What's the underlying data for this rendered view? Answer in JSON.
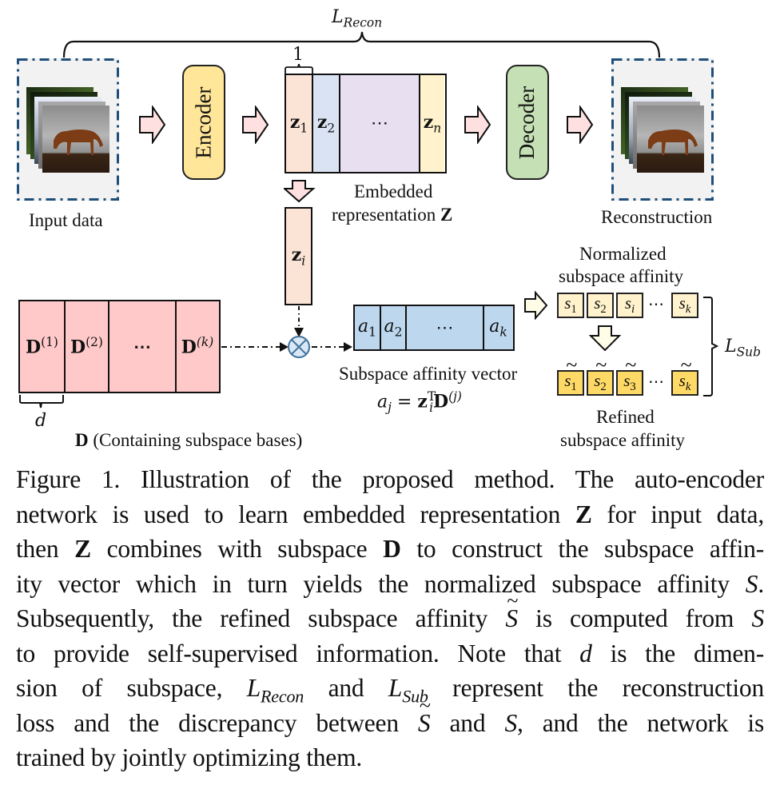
{
  "figure": {
    "loss_recon_label": "L",
    "loss_recon_sub": "Recon",
    "input": {
      "label": "Input data"
    },
    "encoder": {
      "label": "Encoder"
    },
    "decoder": {
      "label": "Decoder"
    },
    "reconstruction": {
      "label": "Reconstruction"
    },
    "embedding": {
      "width_marker": "1",
      "cells": [
        {
          "base": "z",
          "sub": "1",
          "color": "#fbe3d6"
        },
        {
          "base": "z",
          "sub": "2",
          "color": "#dae3f3"
        },
        {
          "base": "⋯",
          "sub": "",
          "color": "#e8e0f0"
        },
        {
          "base": "z",
          "sub": "n",
          "color": "#fff2cc"
        }
      ],
      "label_line1": "Embedded",
      "label_line2": "representation ",
      "label_symbol": "Z"
    },
    "zi": {
      "base": "z",
      "sub": "i"
    },
    "dictionary": {
      "cells": [
        {
          "base": "D",
          "sup": "(1)"
        },
        {
          "base": "D",
          "sup": "(2)"
        },
        {
          "base": "⋯",
          "sup": ""
        },
        {
          "base": "D",
          "sup": "(k)"
        }
      ],
      "dim_label": "d",
      "caption_symbol": "D",
      "caption_text": " (Containing subspace bases)",
      "color": "#ffc9c9"
    },
    "operator": {
      "symbol": "⊗"
    },
    "affinity_vector": {
      "cells": [
        {
          "base": "a",
          "sub": "1"
        },
        {
          "base": "a",
          "sub": "2"
        },
        {
          "base": "⋯",
          "sub": ""
        },
        {
          "base": "a",
          "sub": "k"
        }
      ],
      "label": "Subspace affinity vector",
      "formula_lhs": "a",
      "formula_lhs_sub": "j",
      "formula_eq": " = ",
      "formula_z": "z",
      "formula_z_sub": "i",
      "formula_z_sup": "T",
      "formula_D": "D",
      "formula_D_sup": "(j)",
      "color": "#bdd7ee"
    },
    "normalized": {
      "label_line1": "Normalized",
      "label_line2": "subspace affinity",
      "cells": [
        {
          "base": "s",
          "sub": "1"
        },
        {
          "base": "s",
          "sub": "2"
        },
        {
          "base": "s",
          "sub": "i"
        },
        {
          "base": "s",
          "sub": "k"
        }
      ],
      "ellipsis": "⋯",
      "color": "#fff2cc"
    },
    "refined": {
      "label_line1": "Refined",
      "label_line2": "subspace affinity",
      "cells": [
        {
          "base": "s",
          "sub": "1"
        },
        {
          "base": "s",
          "sub": "2"
        },
        {
          "base": "s",
          "sub": "3"
        },
        {
          "base": "s",
          "sub": "k"
        }
      ],
      "ellipsis": "⋯",
      "color": "#ffd966"
    },
    "loss_sub_label": "L",
    "loss_sub_sub": "Sub",
    "colors": {
      "frame_dash": "#1f4e79",
      "frame_fill": "#f2f2f2",
      "encoder": "#ffe699",
      "decoder": "#c5e0b4",
      "arrow_pink": "#ffe0e0",
      "arrow_cream": "#fffde7",
      "operator_fill": "#dae8f5",
      "operator_stroke": "#41719c"
    }
  },
  "caption": {
    "lines": [
      [
        "Figure 1.  Illustration of the proposed method.  The auto-encoder"
      ],
      [
        "network is used to learn embedded representation ",
        {
          "b": "Z"
        },
        " for input data,"
      ],
      [
        "then ",
        {
          "b": "Z"
        },
        " combines with subspace ",
        {
          "b": "D"
        },
        " to construct the subspace affin-"
      ],
      [
        "ity vector which in turn yields the normalized subspace affinity ",
        {
          "i": "S"
        },
        "."
      ],
      [
        "Subsequently, the refined subspace affinity ",
        {
          "t": "S"
        },
        " is computed from ",
        {
          "i": "S"
        }
      ],
      [
        "to provide self-supervised information.  Note that ",
        {
          "i": "d"
        },
        " is the dimen-"
      ],
      [
        "sion of subspace, ",
        {
          "i": "L",
          "sub": "Recon"
        },
        " and ",
        {
          "i": "L",
          "sub": "Sub"
        },
        " represent the reconstruction"
      ],
      [
        "loss and the discrepancy between ",
        {
          "t": "S"
        },
        " and ",
        {
          "i": "S"
        },
        ", and the network is"
      ],
      [
        "trained by jointly optimizing them."
      ]
    ]
  }
}
